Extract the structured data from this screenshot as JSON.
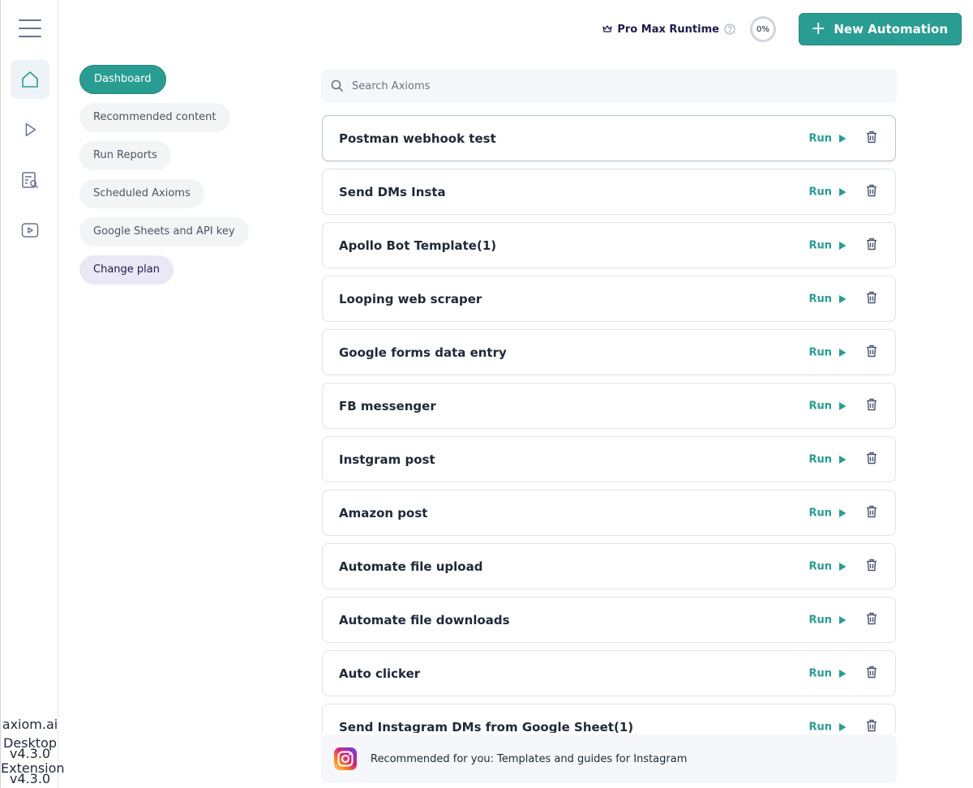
{
  "rail": {
    "items": [
      "home-icon",
      "play-icon",
      "report-search-icon",
      "video-icon"
    ],
    "brand": "axiom.ai",
    "desktop_label": "Desktop",
    "desktop_version": "v4.3.0",
    "extension_label": "Extension",
    "extension_version": "v4.3.0"
  },
  "header": {
    "plan_label": "Pro Max Runtime",
    "usage_percent": "0%",
    "new_button_label": "New Automation"
  },
  "nav": {
    "items": [
      {
        "label": "Dashboard"
      },
      {
        "label": "Recommended content"
      },
      {
        "label": "Run Reports"
      },
      {
        "label": "Scheduled Axioms"
      },
      {
        "label": "Google Sheets and API key"
      },
      {
        "label": "Change plan"
      }
    ],
    "active": "Dashboard"
  },
  "search": {
    "placeholder": "Search Axioms",
    "value": ""
  },
  "automations": {
    "run_label": "Run",
    "items": [
      "Postman webhook test",
      "Send DMs Insta",
      "Apollo Bot Template(1)",
      "Looping web scraper",
      "Google forms data entry",
      "FB messenger",
      "Instgram post",
      "Amazon post",
      "Automate file upload",
      "Automate file downloads",
      "Auto clicker",
      "Send Instagram DMs from Google Sheet(1)"
    ]
  },
  "recommendation": {
    "text": "Recommended for you: Templates and guides for Instagram",
    "icon": "instagram-icon"
  },
  "colors": {
    "accent": "#2a9d92",
    "plan_text": "#1e1b4b"
  }
}
